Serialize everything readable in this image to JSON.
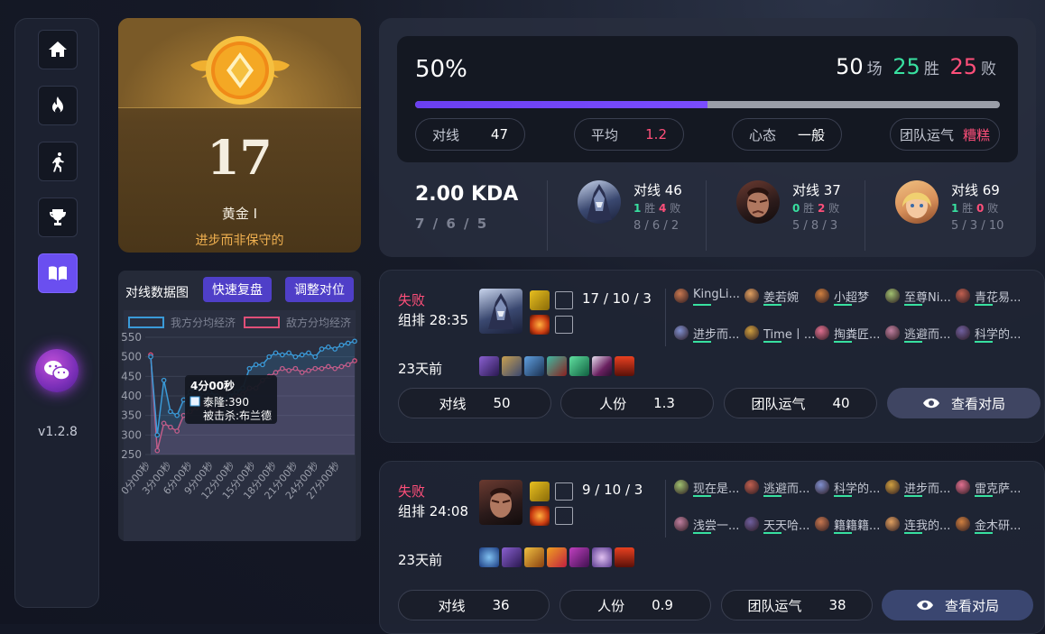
{
  "sidebar": {
    "items": [
      {
        "icon": "home-icon"
      },
      {
        "icon": "fire-icon"
      },
      {
        "icon": "runner-icon"
      },
      {
        "icon": "trophy-icon"
      },
      {
        "icon": "book-icon",
        "active": true
      }
    ],
    "wechat_icon": "wechat-icon",
    "version": "v1.2.8"
  },
  "rank": {
    "number": "17",
    "tier": "黄金 I",
    "motto": "进步而非保守的"
  },
  "summary": {
    "winrate": "50%",
    "winrate_fraction": 0.5,
    "games": "50",
    "games_unit": "场",
    "wins": "25",
    "wins_unit": "胜",
    "losses": "25",
    "losses_unit": "败",
    "stats": [
      {
        "label": "对线",
        "value": "47"
      },
      {
        "label": "平均",
        "value": "1.2"
      },
      {
        "label": "心态",
        "value": "一般"
      },
      {
        "label": "团队运气",
        "value": "糟糕"
      }
    ],
    "kda": "2.00 KDA",
    "kda_detail": "7 / 6 / 5",
    "champions": [
      {
        "line": "对线 46",
        "wins": "1",
        "win_unit": "胜",
        "losses": "4",
        "loss_unit": "败",
        "kda": "8 / 6 / 2"
      },
      {
        "line": "对线 37",
        "wins": "0",
        "win_unit": "胜",
        "losses": "2",
        "loss_unit": "败",
        "kda": "5 / 8 / 3"
      },
      {
        "line": "对线 69",
        "wins": "1",
        "win_unit": "胜",
        "losses": "0",
        "loss_unit": "败",
        "kda": "5 / 3 / 10"
      }
    ]
  },
  "chart_panel": {
    "title": "对线数据图",
    "btn_review": "快速复盘",
    "btn_adjust": "调整对位"
  },
  "chart_data": {
    "type": "area",
    "series": [
      {
        "name": "我方分均经济",
        "color": "#3a9ad8",
        "values": [
          500,
          300,
          440,
          360,
          350,
          390,
          410,
          420,
          400,
          410,
          400,
          390,
          400,
          410,
          420,
          470,
          480,
          480,
          500,
          510,
          505,
          510,
          500,
          505,
          510,
          500,
          520,
          525,
          520,
          530,
          535,
          540
        ]
      },
      {
        "name": "敌方分均经济",
        "color": "#e04f78",
        "values": [
          505,
          260,
          330,
          320,
          310,
          350,
          360,
          370,
          380,
          370,
          360,
          380,
          390,
          400,
          405,
          420,
          420,
          440,
          450,
          460,
          470,
          465,
          470,
          460,
          465,
          470,
          470,
          475,
          470,
          475,
          480,
          490
        ]
      }
    ],
    "x_tick_labels": [
      "0分00秒",
      "3分00秒",
      "6分00秒",
      "9分00秒",
      "12分00秒",
      "15分00秒",
      "18分00秒",
      "21分00秒",
      "24分00秒",
      "27分00秒"
    ],
    "y_ticks": [
      "550",
      "500",
      "450",
      "400",
      "350",
      "300",
      "250"
    ],
    "ylim": [
      250,
      550
    ],
    "tooltip": {
      "title": "4分00秒",
      "line1": "泰隆:390",
      "line2": "被击杀:布兰德"
    }
  },
  "matches": [
    {
      "result": "失败",
      "mode": "组排 28:35",
      "time": "23天前",
      "kda": "17 / 10 / 3",
      "players_left": [
        "KingLi...",
        "姜若婉",
        "小超梦",
        "至尊Ni...",
        "青花易..."
      ],
      "players_right": [
        "进步而...",
        "Time丨...",
        "掏粪匠...",
        "逃避而...",
        "科学的..."
      ],
      "line_label": "对线",
      "line_value": "50",
      "pop_label": "人份",
      "pop_value": "1.3",
      "luck_label": "团队运气",
      "luck_value": "40",
      "view": "查看对局"
    },
    {
      "result": "失败",
      "mode": "组排 24:08",
      "time": "23天前",
      "kda": "9 / 10 / 3",
      "players_left": [
        "现在是...",
        "逃避而...",
        "科学的...",
        "进步而...",
        "雷克萨..."
      ],
      "players_right": [
        "浅尝一...",
        "天天哈...",
        "籍籍籍...",
        "连我的...",
        "金木研..."
      ],
      "line_label": "对线",
      "line_value": "36",
      "pop_label": "人份",
      "pop_value": "0.9",
      "luck_label": "团队运气",
      "luck_value": "38",
      "view": "查看对局"
    }
  ]
}
